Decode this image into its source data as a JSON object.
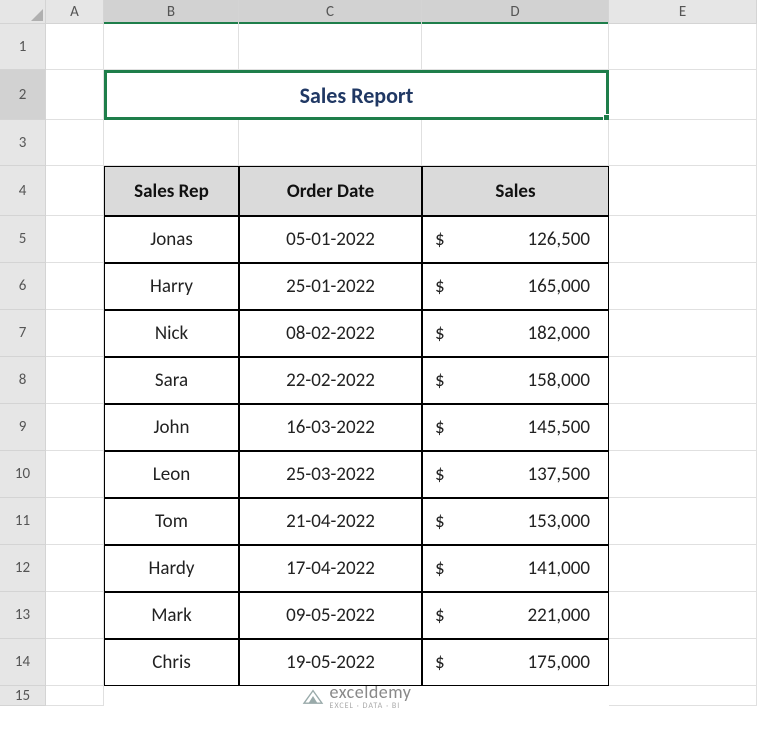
{
  "columns": [
    "A",
    "B",
    "C",
    "D",
    "E"
  ],
  "rows": [
    "1",
    "2",
    "3",
    "4",
    "5",
    "6",
    "7",
    "8",
    "9",
    "10",
    "11",
    "12",
    "13",
    "14",
    "15"
  ],
  "selected_columns": [
    "B",
    "C",
    "D"
  ],
  "selected_row": "2",
  "title": "Sales Report",
  "headers": {
    "rep": "Sales Rep",
    "date": "Order Date",
    "sales": "Sales"
  },
  "data": [
    {
      "rep": "Jonas",
      "date": "05-01-2022",
      "sales": "126,500"
    },
    {
      "rep": "Harry",
      "date": "25-01-2022",
      "sales": "165,000"
    },
    {
      "rep": "Nick",
      "date": "08-02-2022",
      "sales": "182,000"
    },
    {
      "rep": "Sara",
      "date": "22-02-2022",
      "sales": "158,000"
    },
    {
      "rep": "John",
      "date": "16-03-2022",
      "sales": "145,500"
    },
    {
      "rep": "Leon",
      "date": "25-03-2022",
      "sales": "137,500"
    },
    {
      "rep": "Tom",
      "date": "21-04-2022",
      "sales": "153,000"
    },
    {
      "rep": "Hardy",
      "date": "17-04-2022",
      "sales": "141,000"
    },
    {
      "rep": "Mark",
      "date": "09-05-2022",
      "sales": "221,000"
    },
    {
      "rep": "Chris",
      "date": "19-05-2022",
      "sales": "175,000"
    }
  ],
  "currency": "$",
  "watermark": {
    "brand": "exceldemy",
    "tag": "EXCEL · DATA · BI"
  }
}
